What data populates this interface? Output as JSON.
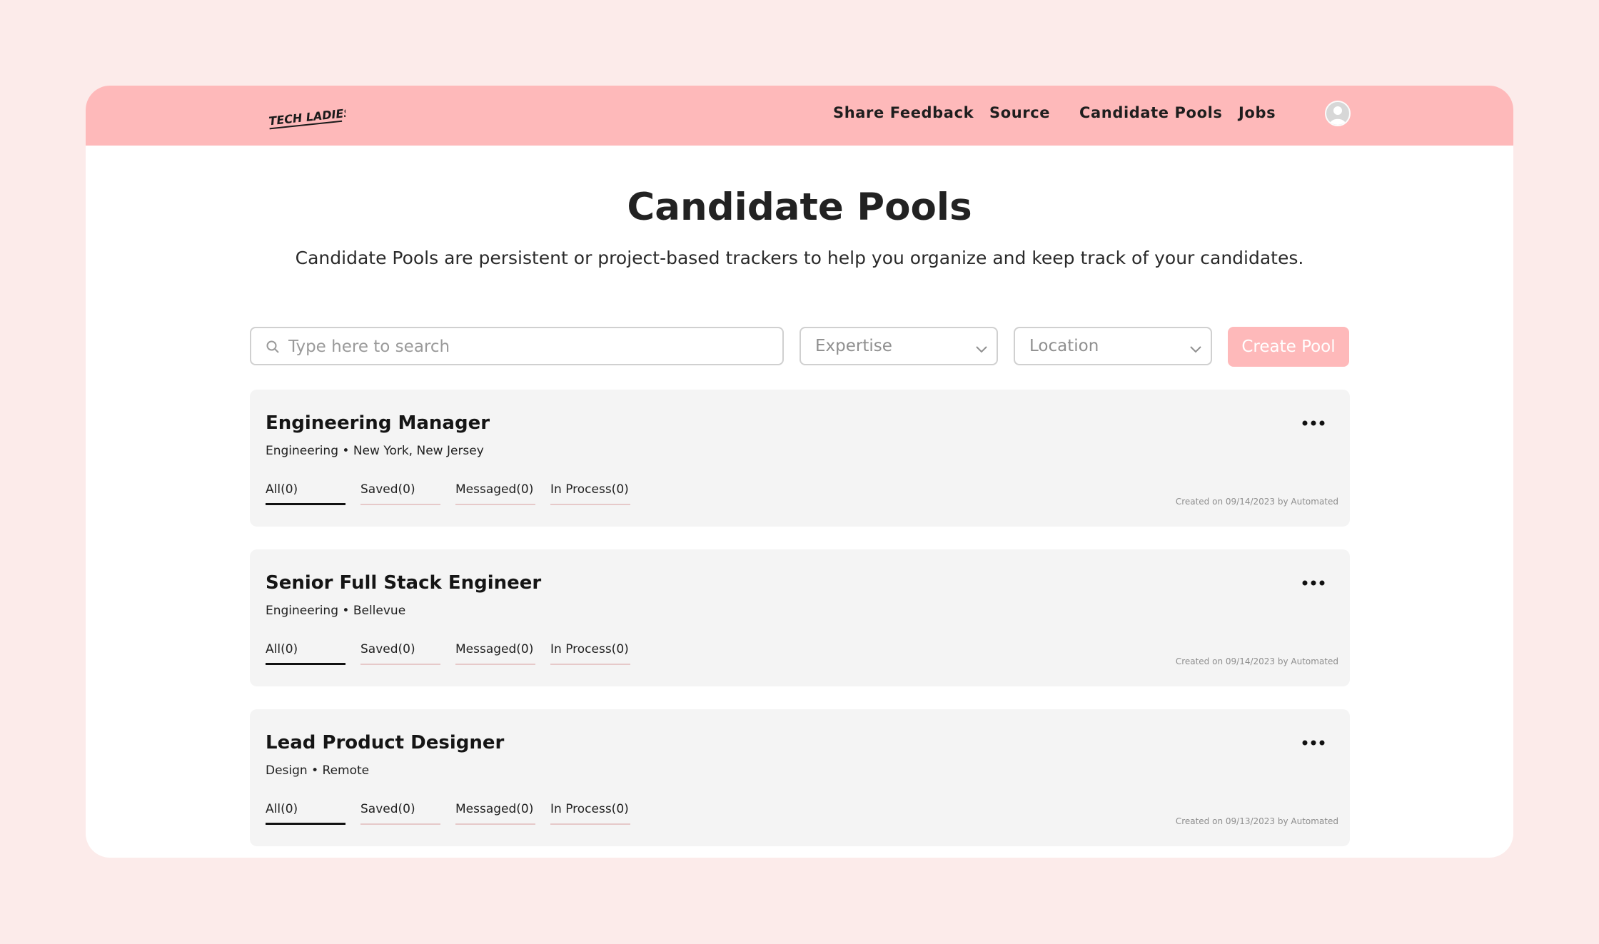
{
  "brand": {
    "logo_text": "TECH LADIES"
  },
  "nav": {
    "items": [
      {
        "label": "Share Feedback"
      },
      {
        "label": "Source"
      },
      {
        "label": "Candidate Pools"
      },
      {
        "label": "Jobs"
      }
    ]
  },
  "header": {
    "title": "Candidate Pools",
    "subtitle": "Candidate Pools are persistent or project-based trackers to help you organize and keep track of your candidates."
  },
  "filters": {
    "search_placeholder": "Type here to search",
    "search_value": "",
    "expertise_label": "Expertise",
    "location_label": "Location",
    "create_label": "Create Pool"
  },
  "pools": [
    {
      "title": "Engineering Manager",
      "meta": "Engineering • New York, New Jersey",
      "tabs": [
        "All(0)",
        "Saved(0)",
        "Messaged(0)",
        "In Process(0)"
      ],
      "created": "Created on 09/14/2023 by Automated"
    },
    {
      "title": "Senior Full Stack Engineer",
      "meta": "Engineering • Bellevue",
      "tabs": [
        "All(0)",
        "Saved(0)",
        "Messaged(0)",
        "In Process(0)"
      ],
      "created": "Created on 09/14/2023 by Automated"
    },
    {
      "title": "Lead Product Designer",
      "meta": "Design • Remote",
      "tabs": [
        "All(0)",
        "Saved(0)",
        "Messaged(0)",
        "In Process(0)"
      ],
      "created": "Created on 09/13/2023 by Automated"
    }
  ],
  "icons": {
    "search": "search-icon",
    "chevron": "chevron-down-icon",
    "more": "more-horizontal-icon",
    "avatar": "user-avatar-icon"
  },
  "colors": {
    "page_background": "#fcebea",
    "navbar": "#feb9ba",
    "card_background": "#f4f4f4",
    "primary_button": "#feb9ba"
  }
}
